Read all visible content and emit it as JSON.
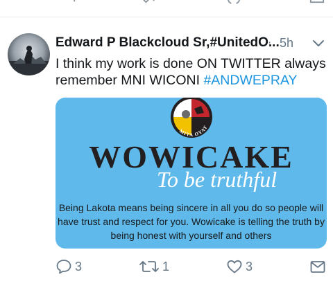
{
  "tweet": {
    "display_name": "Edward P Blackcloud Sr,#UnitedO...",
    "separator": "·",
    "timestamp": "5h",
    "text_before": "I think my work is done ON TWITTER always remember MNI WICONI",
    "hashtag": "#ANDWEPRAY"
  },
  "card": {
    "seal_text": "MITA OYATE",
    "title": "WOWICAKE",
    "subtitle": "To be truthful",
    "body": "Being Lakota means being sincere in all you do so people will have trust and respect for you. Wowicake is telling the truth by being honest with yourself and others"
  },
  "actions": {
    "reply_count": "3",
    "retweet_count": "1",
    "like_count": "3"
  },
  "colors": {
    "accent": "#1b95e0",
    "card_background": "#5fb9ea",
    "icon_gray": "#657786"
  },
  "icons": [
    "reply-icon",
    "retweet-icon",
    "like-icon",
    "direct-message-icon",
    "chevron-down-icon"
  ]
}
